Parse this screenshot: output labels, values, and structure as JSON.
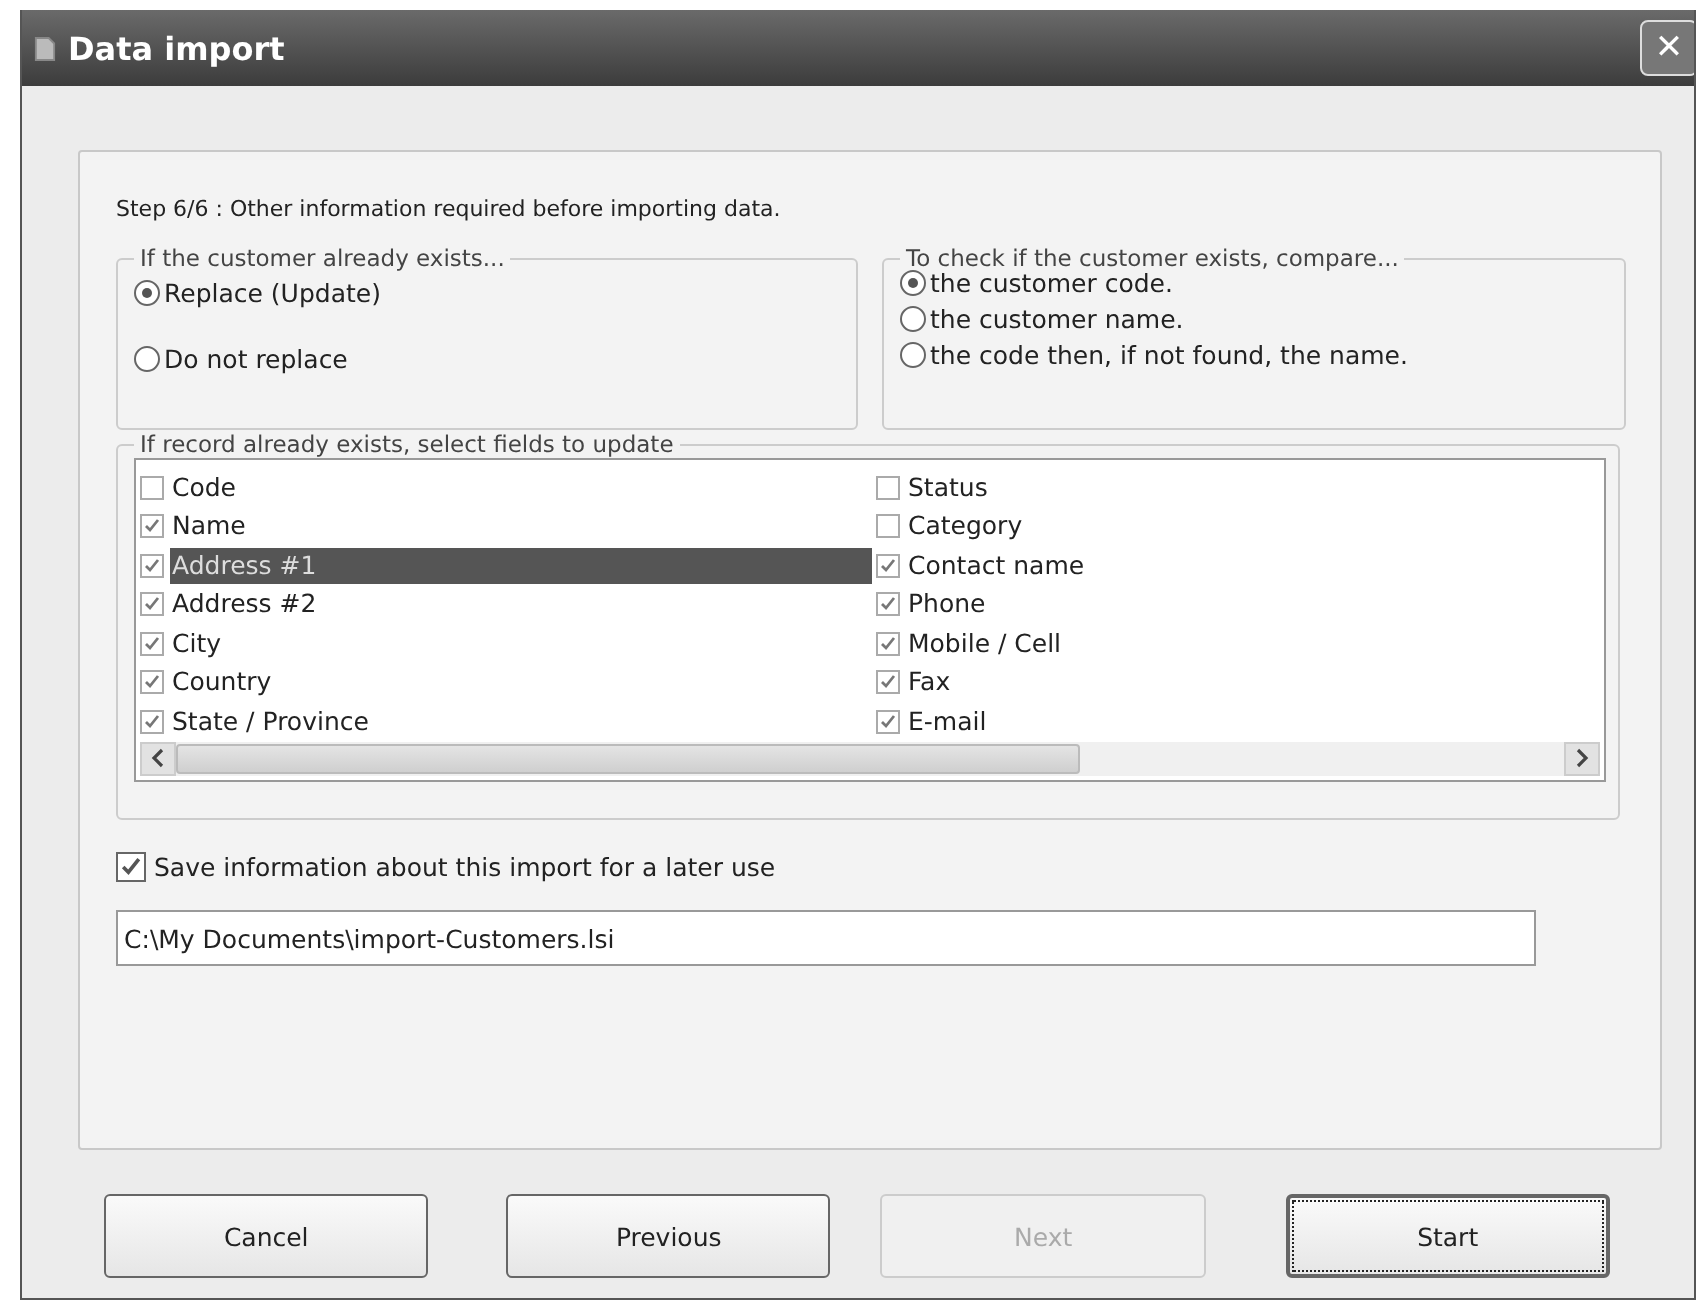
{
  "window": {
    "title": "Data import",
    "close": "✕"
  },
  "step_text": "Step 6/6 : Other information required before importing data.",
  "exists_group": {
    "legend": "If the customer already exists...",
    "options": [
      {
        "label": "Replace (Update)",
        "selected": true
      },
      {
        "label": "Do not replace",
        "selected": false
      }
    ]
  },
  "compare_group": {
    "legend": "To check if the customer exists, compare...",
    "options": [
      {
        "label": "the customer code.",
        "selected": true
      },
      {
        "label": "the customer name.",
        "selected": false
      },
      {
        "label": "the code then, if not found, the name.",
        "selected": false
      }
    ]
  },
  "fields_group": {
    "legend": "If record already exists, select fields to update",
    "columns": [
      [
        {
          "label": "Code",
          "checked": false,
          "selected": false
        },
        {
          "label": "Name",
          "checked": true,
          "selected": false
        },
        {
          "label": "Address #1",
          "checked": true,
          "selected": true
        },
        {
          "label": "Address #2",
          "checked": true,
          "selected": false
        },
        {
          "label": "City",
          "checked": true,
          "selected": false
        },
        {
          "label": "Country",
          "checked": true,
          "selected": false
        },
        {
          "label": "State / Province",
          "checked": true,
          "selected": false
        }
      ],
      [
        {
          "label": "Status",
          "checked": false,
          "selected": false
        },
        {
          "label": "Category",
          "checked": false,
          "selected": false
        },
        {
          "label": "Contact name",
          "checked": true,
          "selected": false
        },
        {
          "label": "Phone",
          "checked": true,
          "selected": false
        },
        {
          "label": "Mobile / Cell",
          "checked": true,
          "selected": false
        },
        {
          "label": "Fax",
          "checked": true,
          "selected": false
        },
        {
          "label": "E-mail",
          "checked": true,
          "selected": false
        }
      ]
    ]
  },
  "save_option": {
    "label": "Save information about this import for a later use",
    "checked": true
  },
  "path_field": {
    "value": "C:\\My Documents\\import-Customers.lsi"
  },
  "buttons": [
    {
      "label": "Cancel",
      "disabled": false,
      "focused": false
    },
    {
      "label": "Previous",
      "disabled": false,
      "focused": false
    },
    {
      "label": "Next",
      "disabled": true,
      "focused": false
    },
    {
      "label": "Start",
      "disabled": false,
      "focused": true
    }
  ]
}
